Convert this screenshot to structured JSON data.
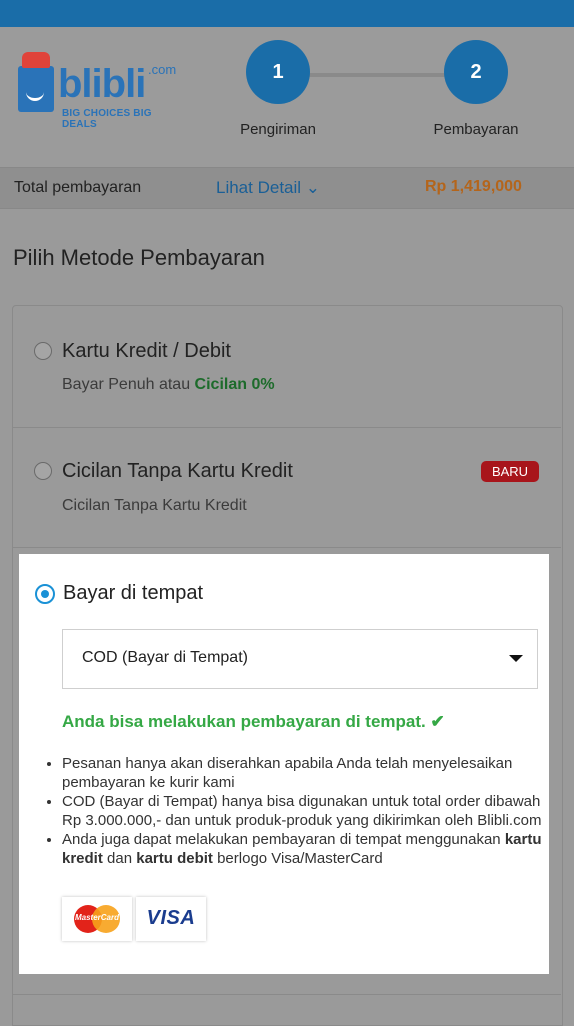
{
  "brand": {
    "name": "blibli",
    "suffix": ".com",
    "tagline": "BIG CHOICES  BIG DEALS"
  },
  "steps": [
    {
      "number": "1",
      "label": "Pengiriman"
    },
    {
      "number": "2",
      "label": "Pembayaran"
    }
  ],
  "total": {
    "label": "Total pembayaran",
    "detail_link": "Lihat Detail ⌄",
    "amount": "Rp 1,419,000"
  },
  "section_title": "Pilih Metode Pembayaran",
  "options": [
    {
      "title": "Kartu Kredit / Debit",
      "subtitle_prefix": "Bayar Penuh atau ",
      "subtitle_highlight": "Cicilan 0%"
    },
    {
      "title": "Cicilan Tanpa Kartu Kredit",
      "subtitle": "Cicilan Tanpa Kartu Kredit",
      "badge": "BARU"
    }
  ],
  "selected": {
    "title": "Bayar di tempat",
    "select_value": "COD (Bayar di Tempat)",
    "success_message": "Anda bisa melakukan pembayaran di tempat. ✔",
    "notes": [
      "Pesanan hanya akan diserahkan apabila Anda telah menyelesaikan pembayaran ke kurir kami",
      "COD (Bayar di Tempat) hanya bisa digunakan untuk total order dibawah Rp 3.000.000,- dan untuk produk-produk yang dikirimkan oleh Blibli.com"
    ],
    "note3": {
      "prefix": "Anda juga dapat melakukan pembayaran di tempat menggunakan ",
      "bold1": "kartu kredit",
      "mid": " dan ",
      "bold2": "kartu debit",
      "suffix": " berlogo Visa/MasterCard"
    },
    "card_logos": {
      "mastercard": "MasterCard",
      "visa": "VISA"
    }
  },
  "colors": {
    "primary": "#1a6da8",
    "accent_amount": "#b4651b",
    "success": "#35a845",
    "badge": "#a8151b"
  }
}
